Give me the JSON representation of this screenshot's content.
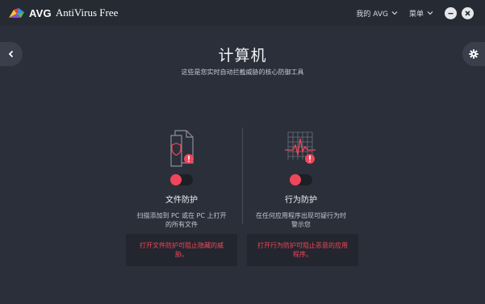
{
  "titlebar": {
    "brand": "AVG",
    "product": "AntiVirus Free",
    "my_avg": "我的 AVG",
    "menu": "菜单"
  },
  "page": {
    "title": "计算机",
    "subtitle": "这些是您实时自动拦截威胁的核心防御工具"
  },
  "features": [
    {
      "name": "文件防护",
      "desc": "扫描添加到 PC 或在 PC 上打开的所有文件",
      "enabled": false,
      "warning": "打开文件防护可阻止隐藏的威胁。"
    },
    {
      "name": "行为防护",
      "desc": "在任何应用程序出现可疑行为时警示您",
      "enabled": false,
      "warning": "打开行为防护可阻止恶意的应用程序。"
    }
  ],
  "colors": {
    "accent": "#f0465b",
    "background": "#2b2f3a",
    "titlebar": "#262a33"
  },
  "icons": {
    "back": "chevron-left-icon",
    "settings": "gear-icon",
    "minimize": "minimize-icon",
    "close": "close-icon"
  }
}
